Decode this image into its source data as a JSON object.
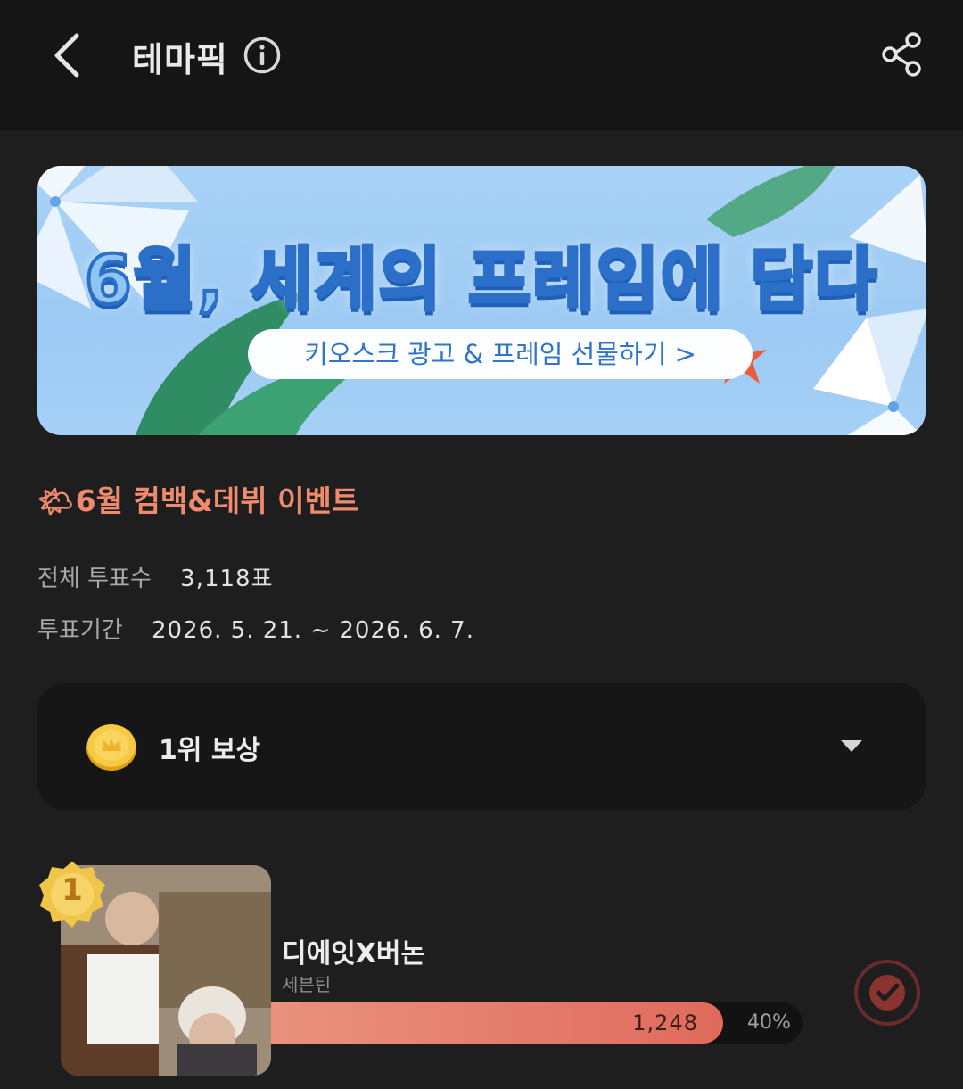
{
  "header": {
    "title": "테마픽"
  },
  "banner": {
    "headline": "6월, 세계의 프레임에 담다",
    "cta": "키오스크 광고 & 프레임 선물하기 >"
  },
  "event": {
    "title": "6월 컴백&데뷔 이벤트",
    "total_votes_label": "전체 투표수",
    "total_votes_value": "3,118표",
    "period_label": "투표기간",
    "period_value": "2026. 5. 21. ~ 2026. 6. 7."
  },
  "reward": {
    "label": "1위 보상"
  },
  "ranking": [
    {
      "rank": "1",
      "name": "디에잇X버논",
      "group": "세븐틴",
      "votes": "1,248",
      "percent_label": "40%",
      "share": 0.85
    }
  ],
  "colors": {
    "accent": "#f08a6e",
    "bar_start": "#e9927e",
    "bar_end": "#e06a5c"
  }
}
